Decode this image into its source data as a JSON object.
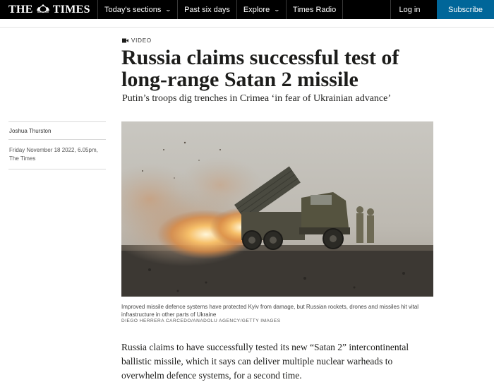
{
  "nav": {
    "logo_left": "THE",
    "logo_right": "TIMES",
    "items": [
      {
        "label": "Today's sections",
        "has_chevron": true
      },
      {
        "label": "Past six days",
        "has_chevron": false
      },
      {
        "label": "Explore",
        "has_chevron": true
      },
      {
        "label": "Times Radio",
        "has_chevron": false
      }
    ],
    "login_label": "Log in",
    "subscribe_label": "Subscribe",
    "subscribe_color": "#006699",
    "chevron_glyph": "⌄"
  },
  "article": {
    "label": "VIDEO",
    "headline": "Russia claims successful test of long-range Satan 2 missile",
    "standfirst": "Putin’s troops dig trenches in Crimea ‘in fear of Ukrainian advance’",
    "author": "Joshua Thurston",
    "date_line_1": "Friday November 18 2022, 6.05pm,",
    "date_line_2": "The Times",
    "image_alt": "Rocket launcher truck firing rockets",
    "caption": "Improved missile defence systems have protected Kyiv from damage, but Russian rockets, drones and missiles hit vital infrastructure in other parts of Ukraine",
    "credit": "DIEGO HERRERA CARCEDO/ANADOLU AGENCY/GETTY IMAGES",
    "body": "Russia claims to have successfully tested its new “Satan 2” intercontinental ballistic missile, which it says can deliver multiple nuclear warheads to overwhelm defence systems, for a second time."
  }
}
